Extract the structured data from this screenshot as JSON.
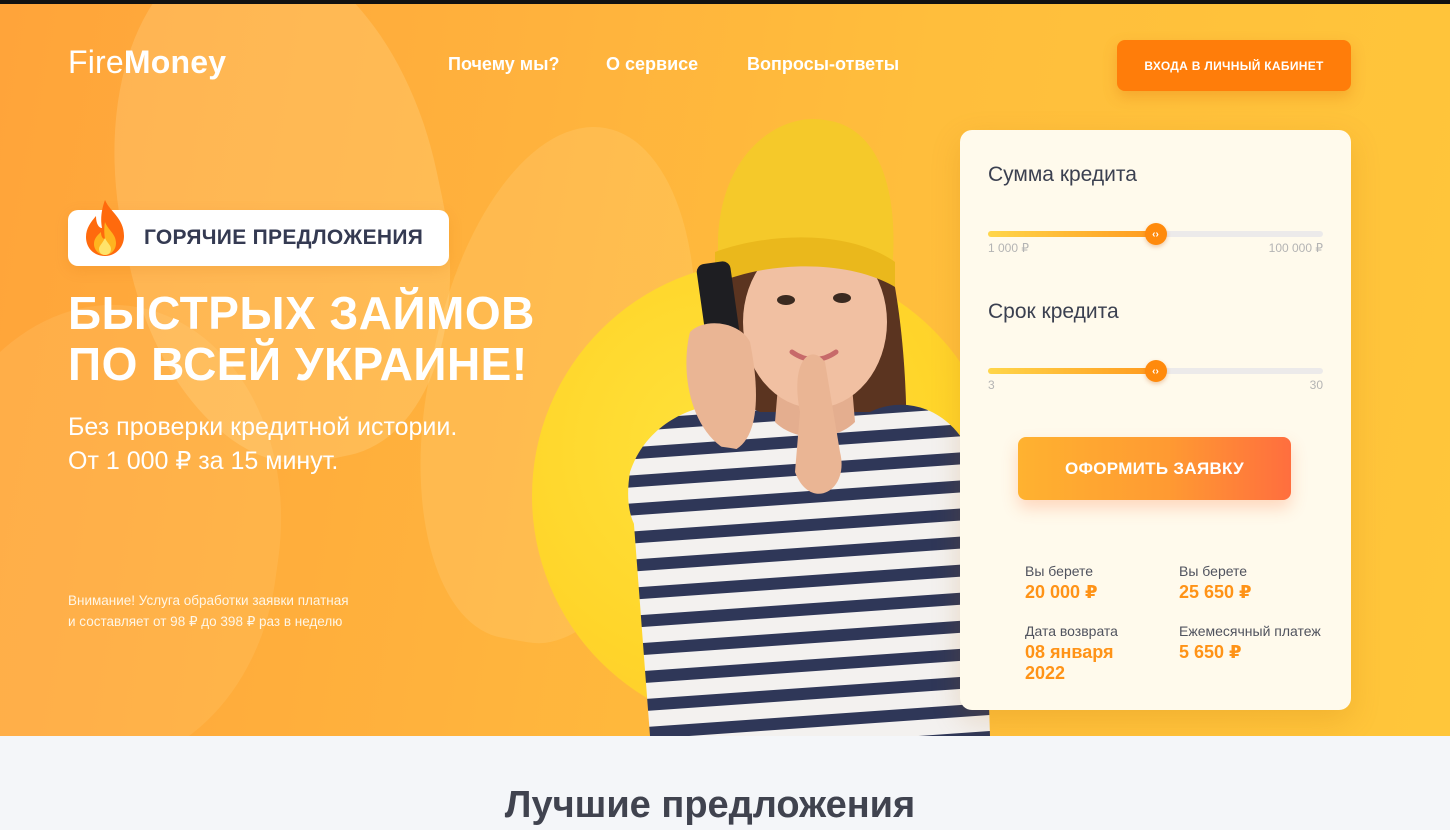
{
  "header": {
    "logo_light": "Fire",
    "logo_bold": "Money",
    "nav": [
      "Почему мы?",
      "О сервисе",
      "Вопросы-ответы"
    ],
    "cabinet_button": "ВХОДА В ЛИЧНЫЙ КАБИНЕТ"
  },
  "hero": {
    "badge": "ГОРЯЧИЕ ПРЕДЛОЖЕНИЯ",
    "headline_line1": "БЫСТРЫХ ЗАЙМОВ",
    "headline_line2": "ПО ВСЕЙ УКРАИНЕ!",
    "sub_line1": "Без проверки кредитной истории.",
    "sub_line2": "От 1 000 ₽ за 15 минут.",
    "note_line1": "Внимание! Услуга обработки заявки платная",
    "note_line2": "и составляет от 98 ₽ до 398 ₽ раз в неделю"
  },
  "calculator": {
    "amount": {
      "title": "Сумма кредита",
      "min_label": "1 000 ₽",
      "max_label": "100 000 ₽",
      "fraction": 0.5
    },
    "term": {
      "title": "Срок кредита",
      "min_label": "3",
      "max_label": "30",
      "fraction": 0.5
    },
    "thumb_glyph": "‹›",
    "apply_button": "ОФОРМИТЬ ЗАЯВКУ",
    "summary": {
      "take1_label": "Вы берете",
      "take1_value": "20 000 ₽",
      "take2_label": "Вы берете",
      "take2_value": "25 650 ₽",
      "return_label": "Дата возврата",
      "return_value_line1": "08 января",
      "return_value_line2": "2022",
      "monthly_label": "Ежемесячный платеж",
      "monthly_value": "5 650 ₽"
    }
  },
  "sections": {
    "best_offers_title": "Лучшие предложения"
  },
  "colors": {
    "accent_orange": "#ff7d0a",
    "value_orange": "#ff9317",
    "hero_yellow": "#ffc63a"
  },
  "icons": {
    "badge_icon": "fire-icon",
    "slider_thumb": "slider-arrows-icon"
  }
}
